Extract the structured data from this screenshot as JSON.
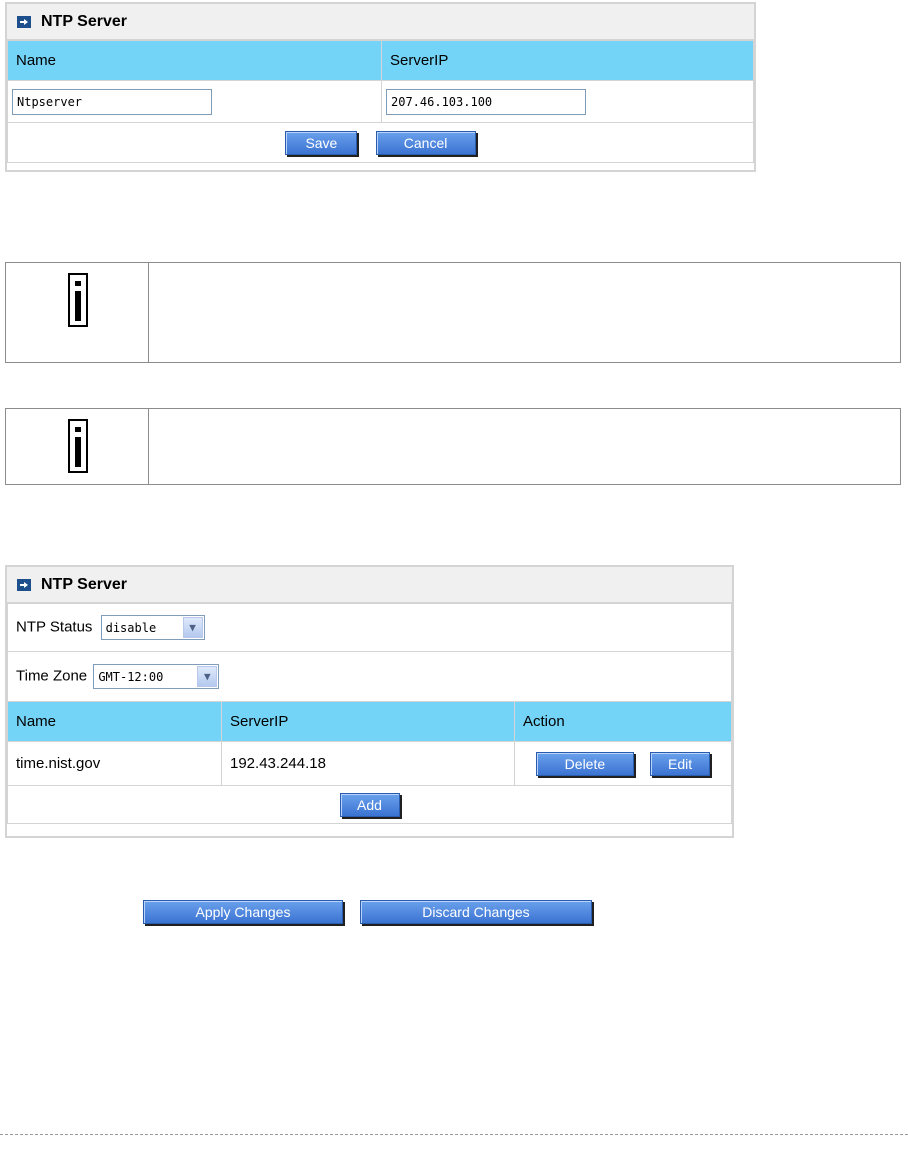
{
  "panel1": {
    "title": "NTP Server",
    "col_name": "Name",
    "col_serverip": "ServerIP",
    "name_value": "Ntpserver",
    "serverip_value": "207.46.103.100",
    "save_label": "Save",
    "cancel_label": "Cancel"
  },
  "panel2": {
    "title": "NTP Server",
    "ntp_status_label": "NTP Status",
    "ntp_status_value": "disable",
    "time_zone_label": "Time Zone",
    "time_zone_value": "GMT-12:00",
    "col_name": "Name",
    "col_serverip": "ServerIP",
    "col_action": "Action",
    "rows": [
      {
        "name": "time.nist.gov",
        "serverip": "192.43.244.18",
        "delete_label": "Delete",
        "edit_label": "Edit"
      }
    ],
    "add_label": "Add"
  },
  "actions": {
    "apply_label": "Apply Changes",
    "discard_label": "Discard Changes"
  },
  "icons": {
    "header": "arrow-right-icon",
    "note": "info-icon",
    "dropdown": "chevron-down-icon"
  },
  "colors": {
    "table_header": "#74d4f7",
    "button": "#3b73d2",
    "panel_header": "#f0f0f0"
  }
}
